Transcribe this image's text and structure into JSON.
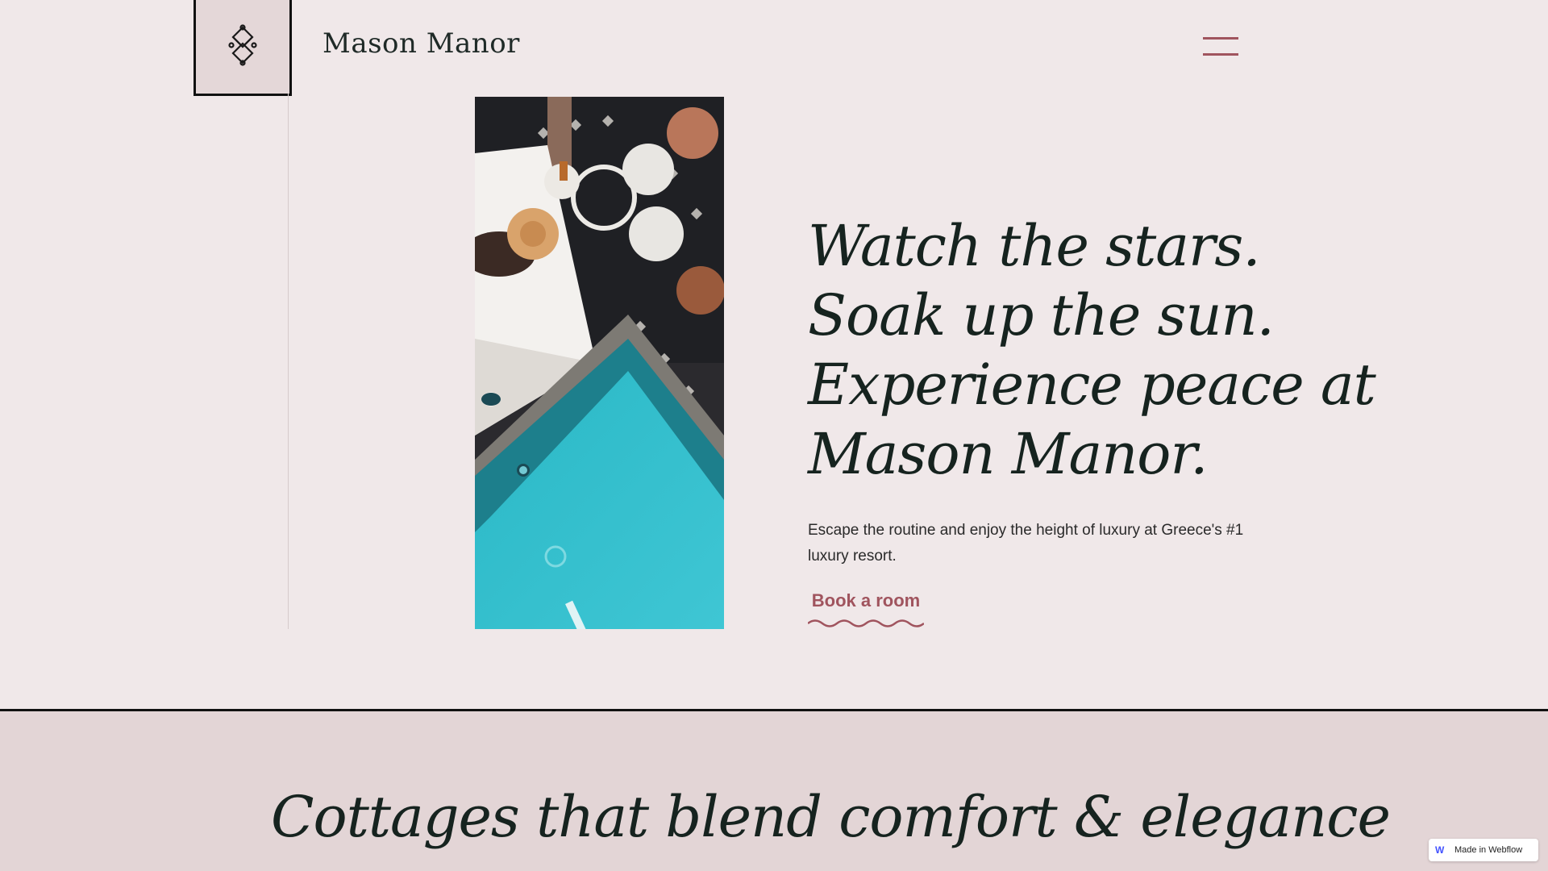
{
  "header": {
    "brand": "Mason Manor",
    "logo_icon": "knot-icon",
    "menu_icon": "hamburger-icon"
  },
  "hero": {
    "headline_lines": [
      "Watch the stars.",
      "Soak up the sun.",
      "Experience peace at",
      "Mason Manor."
    ],
    "description": "Escape the routine and enjoy the height of luxury at Greece's #1 luxury resort.",
    "cta": "Book a room"
  },
  "section2": {
    "title": "Cottages that blend comfort & elegance"
  },
  "badge": {
    "text": "Made in Webflow"
  },
  "colors": {
    "background": "#f0e8e9",
    "accent": "#a0545e",
    "text": "#16231f",
    "lower_bg": "#e3d5d6"
  }
}
